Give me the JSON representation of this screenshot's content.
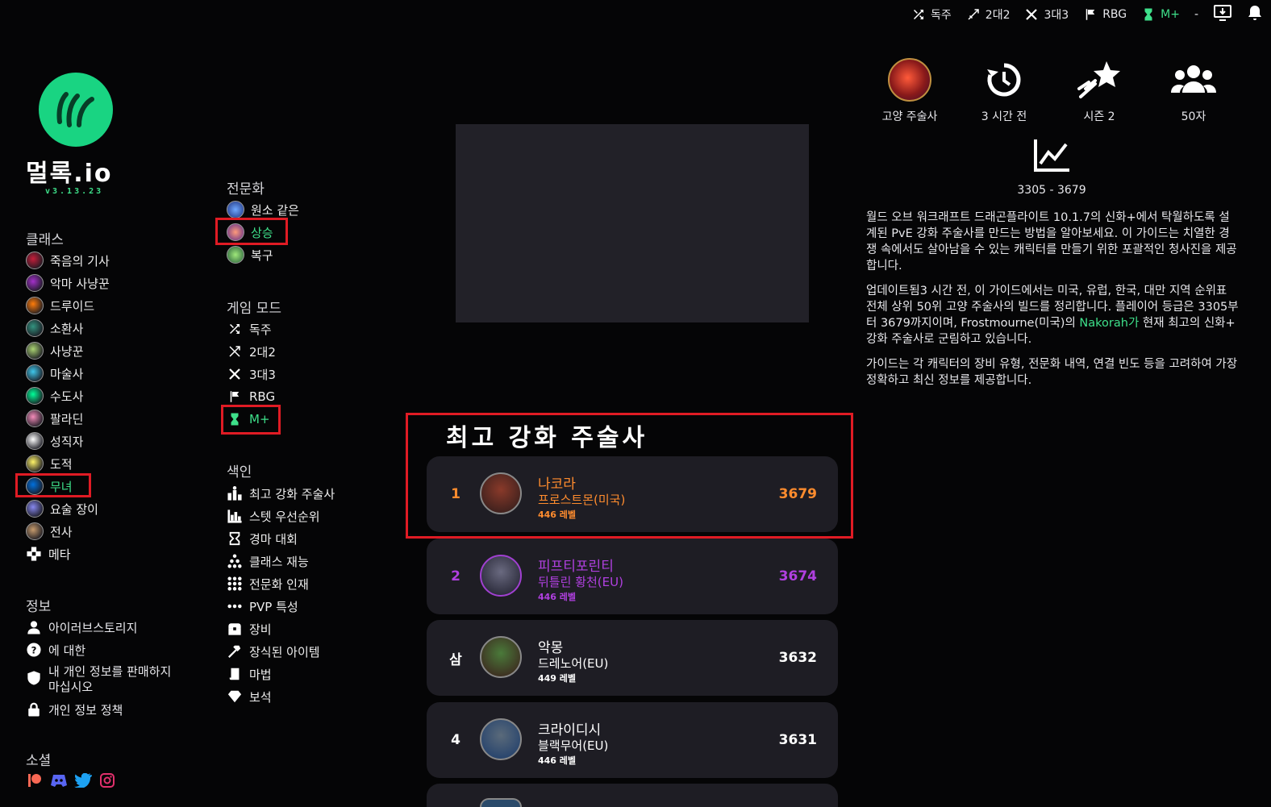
{
  "topbar": {
    "items": [
      {
        "label": "독주",
        "icon": "shuffle-icon"
      },
      {
        "label": "2대2",
        "icon": "swords-icon"
      },
      {
        "label": "3대3",
        "icon": "crossed-swords-icon"
      },
      {
        "label": "RBG",
        "icon": "flag-icon"
      },
      {
        "label": "M+",
        "icon": "hourglass-icon",
        "active": true
      }
    ],
    "dash": "-",
    "accent": "#3ee08a"
  },
  "brand": {
    "title": "멀록.io",
    "version": "v3.13.23",
    "logo_color": "#19d482"
  },
  "classes": {
    "title": "클래스",
    "items": [
      {
        "label": "죽음의 기사",
        "color": "#c41e3a"
      },
      {
        "label": "악마 사냥꾼",
        "color": "#a330c9"
      },
      {
        "label": "드루이드",
        "color": "#ff7c0a"
      },
      {
        "label": "소환사",
        "color": "#33937f"
      },
      {
        "label": "사냥꾼",
        "color": "#aad372"
      },
      {
        "label": "마술사",
        "color": "#3fc7eb"
      },
      {
        "label": "수도사",
        "color": "#00ff98"
      },
      {
        "label": "팔라딘",
        "color": "#f48cba"
      },
      {
        "label": "성직자",
        "color": "#ffffff"
      },
      {
        "label": "도적",
        "color": "#fff468"
      },
      {
        "label": "무녀",
        "color": "#0070dd",
        "active": true
      },
      {
        "label": "요술 장이",
        "color": "#8788ee"
      },
      {
        "label": "전사",
        "color": "#c69b6d"
      },
      {
        "label": "메타",
        "icon": "puzzle-icon"
      }
    ]
  },
  "info": {
    "title": "정보",
    "items": [
      {
        "label": "아이러브스토리지",
        "icon": "user-icon"
      },
      {
        "label": "에 대한",
        "icon": "question-icon"
      },
      {
        "label": "내 개인 정보를 판매하지 마십시오",
        "icon": "shield-icon"
      },
      {
        "label": "개인 정보 정책",
        "icon": "lock-icon"
      }
    ]
  },
  "social": {
    "title": "소셜",
    "items": [
      "patreon-icon",
      "discord-icon",
      "twitter-icon",
      "instagram-icon"
    ]
  },
  "specs": {
    "title": "전문화",
    "items": [
      {
        "label": "원소 같은"
      },
      {
        "label": "상승",
        "active": true
      },
      {
        "label": "복구"
      }
    ]
  },
  "modes": {
    "title": "게임 모드",
    "items": [
      {
        "label": "독주",
        "icon": "shuffle-icon"
      },
      {
        "label": "2대2",
        "icon": "swords-icon"
      },
      {
        "label": "3대3",
        "icon": "crossed-swords-icon"
      },
      {
        "label": "RBG",
        "icon": "flag-icon"
      },
      {
        "label": "M+",
        "icon": "hourglass-icon",
        "active": true
      }
    ]
  },
  "index": {
    "title": "색인",
    "items": [
      {
        "label": "최고 강화 주술사",
        "icon": "ranking-icon"
      },
      {
        "label": "스텟 우선순위",
        "icon": "bar-chart-icon"
      },
      {
        "label": "경마 대회",
        "icon": "hourglass-outline-icon"
      },
      {
        "label": "클래스 재능",
        "icon": "talent-tree-icon"
      },
      {
        "label": "전문화 인재",
        "icon": "grid-dots-icon"
      },
      {
        "label": "PVP 특성",
        "icon": "dots-icon"
      },
      {
        "label": "장비",
        "icon": "chest-icon"
      },
      {
        "label": "장식된 아이템",
        "icon": "hammer-icon"
      },
      {
        "label": "마법",
        "icon": "scroll-icon"
      },
      {
        "label": "보석",
        "icon": "gem-icon"
      }
    ]
  },
  "leaderboard": {
    "title": "최고 강화 주술사",
    "rows": [
      {
        "rank": "1",
        "name": "나코라",
        "realm": "프로스트몬(미국)",
        "level": "446 레벨",
        "score": "3679",
        "color": "#ff8c2e"
      },
      {
        "rank": "2",
        "name": "피프티포린티",
        "realm": "뒤틀린 황천(EU)",
        "level": "446 레벨",
        "score": "3674",
        "color": "#b040e0"
      },
      {
        "rank": "삼",
        "name": "악몽",
        "realm": "드레노어(EU)",
        "level": "449 레벨",
        "score": "3632",
        "color": "#ffffff"
      },
      {
        "rank": "4",
        "name": "크라이디시",
        "realm": "블랙무어(EU)",
        "level": "446 레벨",
        "score": "3631",
        "color": "#ffffff"
      }
    ]
  },
  "stats": {
    "spec": "고양 주술사",
    "updated": "3 시간 전",
    "season": "시즌 2",
    "count": "50자",
    "range": "3305 - 3679"
  },
  "description": {
    "p1": "월드 오브 워크래프트 드래곤플라이트 10.1.7의 신화+에서 탁월하도록 설계된 PvE 강화 주술사를 만드는 방법을 알아보세요. 이 가이드는 치열한 경쟁 속에서도 살아남을 수 있는 캐릭터를 만들기 위한 포괄적인 청사진을 제공합니다.",
    "p2_a": "업데이트됨3 시간 전, 이 가이드에서는 미국, 유럽, 한국, 대만 지역 순위표 전체 상위 50위 고양 주술사의 빌드를 정리합니다. 플레이어 등급은 3305부터 3679까지이며, Frostmourne(미국)의 ",
    "p2_hl": "Nakorah가",
    "p2_b": " 현재 최고의 신화+ 강화 주술사로 군림하고 있습니다.",
    "p3": "가이드는 각 캐릭터의 장비 유형, 전문화 내역, 연결 빈도 등을 고려하여 가장 정확하고 최신 정보를 제공합니다."
  }
}
